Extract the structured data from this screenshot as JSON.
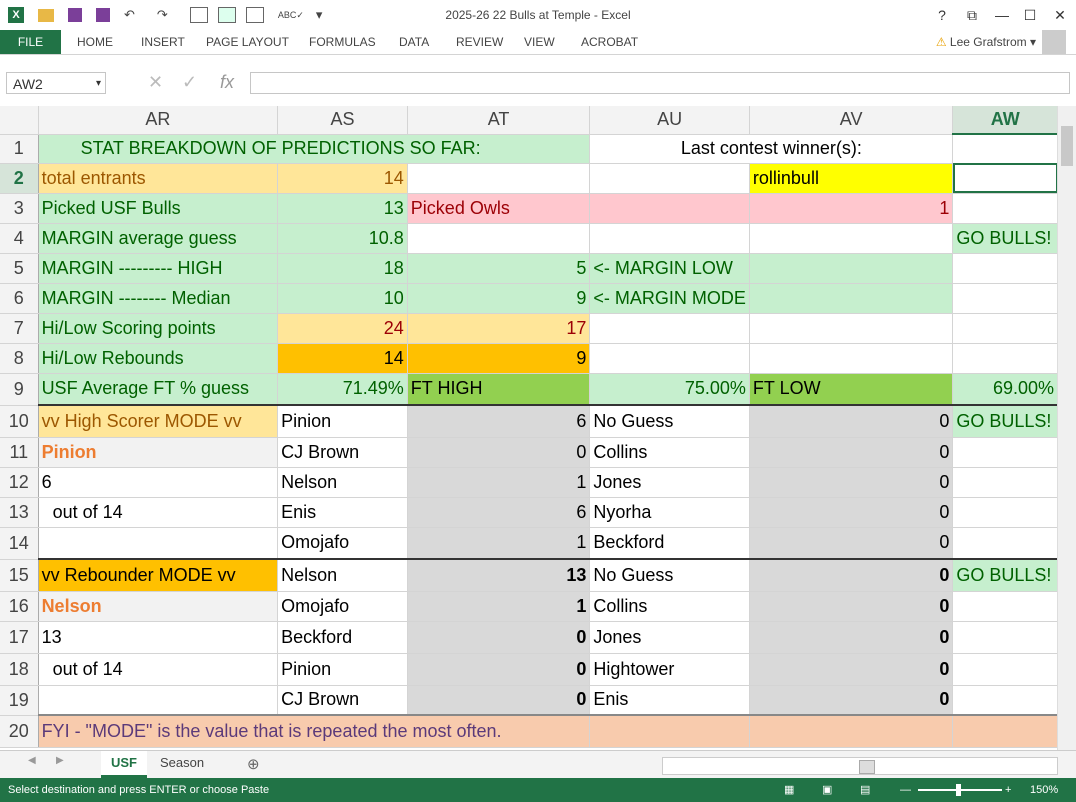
{
  "window": {
    "title": "2025-26  22 Bulls at Temple - Excel",
    "help": "?",
    "restore": "⧉",
    "minimize": "—",
    "maximize": "☐",
    "close": "✕"
  },
  "ribbon": {
    "tabs": [
      "FILE",
      "HOME",
      "INSERT",
      "PAGE LAYOUT",
      "FORMULAS",
      "DATA",
      "REVIEW",
      "VIEW",
      "ACROBAT"
    ],
    "user": "Lee Grafstrom"
  },
  "formula_bar": {
    "name_box": "AW2",
    "fx": "fx",
    "value": ""
  },
  "columns": [
    "AR",
    "AS",
    "AT",
    "AU",
    "AV",
    "AW"
  ],
  "rows": [
    {
      "n": "1",
      "cells": [
        {
          "t": "STAT BREAKDOWN OF PREDICTIONS SO FAR:",
          "c": "g",
          "span": 3,
          "indent": true
        },
        {
          "t": "Last contest winner(s):",
          "c": "",
          "span": 2,
          "center": true
        },
        {
          "t": "",
          "c": ""
        }
      ]
    },
    {
      "n": "2",
      "cells": [
        {
          "t": "total entrants",
          "c": "y"
        },
        {
          "t": "14",
          "c": "y num"
        },
        {
          "t": "",
          "c": ""
        },
        {
          "t": "",
          "c": ""
        },
        {
          "t": "rollinbull",
          "c": "yel"
        },
        {
          "t": "",
          "c": "sel"
        }
      ]
    },
    {
      "n": "3",
      "cells": [
        {
          "t": "Picked USF Bulls",
          "c": "g"
        },
        {
          "t": "13",
          "c": "g num"
        },
        {
          "t": "Picked Owls",
          "c": "pk"
        },
        {
          "t": "",
          "c": "pk"
        },
        {
          "t": "1",
          "c": "pk num"
        },
        {
          "t": "",
          "c": ""
        }
      ]
    },
    {
      "n": "4",
      "cells": [
        {
          "t": "MARGIN average guess",
          "c": "g"
        },
        {
          "t": "10.8",
          "c": "g num"
        },
        {
          "t": "",
          "c": ""
        },
        {
          "t": "",
          "c": ""
        },
        {
          "t": "",
          "c": ""
        },
        {
          "t": "GO BULLS!",
          "c": "g"
        }
      ]
    },
    {
      "n": "5",
      "cells": [
        {
          "t": "MARGIN ---------    HIGH",
          "c": "g"
        },
        {
          "t": "18",
          "c": "g num"
        },
        {
          "t": "5",
          "c": "g num"
        },
        {
          "t": "<- MARGIN LOW",
          "c": "g"
        },
        {
          "t": "",
          "c": "g"
        },
        {
          "t": "",
          "c": ""
        }
      ]
    },
    {
      "n": "6",
      "cells": [
        {
          "t": "MARGIN -------- Median",
          "c": "g"
        },
        {
          "t": "10",
          "c": "g num"
        },
        {
          "t": "9",
          "c": "g num"
        },
        {
          "t": "<- MARGIN MODE",
          "c": "g"
        },
        {
          "t": "",
          "c": "g"
        },
        {
          "t": "",
          "c": ""
        }
      ]
    },
    {
      "n": "7",
      "cells": [
        {
          "t": "Hi/Low Scoring points",
          "c": "g"
        },
        {
          "t": "24",
          "c": "y num darkred"
        },
        {
          "t": "17",
          "c": "y num darkred"
        },
        {
          "t": "",
          "c": ""
        },
        {
          "t": "",
          "c": ""
        },
        {
          "t": "",
          "c": ""
        }
      ]
    },
    {
      "n": "8",
      "cells": [
        {
          "t": "Hi/Low Rebounds",
          "c": "g"
        },
        {
          "t": "14",
          "c": "o num"
        },
        {
          "t": "9",
          "c": "o num"
        },
        {
          "t": "",
          "c": ""
        },
        {
          "t": "",
          "c": ""
        },
        {
          "t": "",
          "c": ""
        }
      ]
    },
    {
      "n": "9",
      "cells": [
        {
          "t": "USF Average FT % guess",
          "c": "g"
        },
        {
          "t": "71.49%",
          "c": "g num"
        },
        {
          "t": "FT HIGH",
          "c": "dg"
        },
        {
          "t": "75.00%",
          "c": "g num"
        },
        {
          "t": "FT LOW",
          "c": "dg"
        },
        {
          "t": "69.00%",
          "c": "g num"
        }
      ]
    },
    {
      "n": "10",
      "cells": [
        {
          "t": "vv High Scorer MODE  vv",
          "c": "y"
        },
        {
          "t": "Pinion",
          "c": ""
        },
        {
          "t": "6",
          "c": "gray num"
        },
        {
          "t": "No Guess",
          "c": ""
        },
        {
          "t": "0",
          "c": "gray num"
        },
        {
          "t": "GO BULLS!",
          "c": "g"
        }
      ]
    },
    {
      "n": "11",
      "cells": [
        {
          "t": "Pinion",
          "c": "orange-t"
        },
        {
          "t": "CJ Brown",
          "c": ""
        },
        {
          "t": "0",
          "c": "gray num"
        },
        {
          "t": "Collins",
          "c": ""
        },
        {
          "t": "0",
          "c": "gray num"
        },
        {
          "t": "",
          "c": ""
        }
      ]
    },
    {
      "n": "12",
      "cells": [
        {
          "t": "6",
          "c": ""
        },
        {
          "t": "Nelson",
          "c": ""
        },
        {
          "t": "1",
          "c": "gray num"
        },
        {
          "t": "Jones",
          "c": ""
        },
        {
          "t": "0",
          "c": "gray num"
        },
        {
          "t": "",
          "c": ""
        }
      ]
    },
    {
      "n": "13",
      "cells": [
        {
          "t": "  out of 14",
          "c": ""
        },
        {
          "t": "Enis",
          "c": ""
        },
        {
          "t": "6",
          "c": "gray num"
        },
        {
          "t": "Nyorha",
          "c": ""
        },
        {
          "t": "0",
          "c": "gray num"
        },
        {
          "t": "",
          "c": ""
        }
      ]
    },
    {
      "n": "14",
      "cells": [
        {
          "t": "",
          "c": ""
        },
        {
          "t": "Omojafo",
          "c": ""
        },
        {
          "t": "1",
          "c": "gray num"
        },
        {
          "t": "Beckford",
          "c": ""
        },
        {
          "t": "0",
          "c": "gray num"
        },
        {
          "t": "",
          "c": ""
        }
      ]
    },
    {
      "n": "15",
      "cells": [
        {
          "t": "vv  Rebounder MODE vv",
          "c": "o"
        },
        {
          "t": "Nelson",
          "c": ""
        },
        {
          "t": "13",
          "c": "gray num b"
        },
        {
          "t": "No Guess",
          "c": ""
        },
        {
          "t": "0",
          "c": "gray num b"
        },
        {
          "t": "GO BULLS!",
          "c": "g"
        }
      ]
    },
    {
      "n": "16",
      "cells": [
        {
          "t": "Nelson",
          "c": "orange-t"
        },
        {
          "t": "Omojafo",
          "c": ""
        },
        {
          "t": "1",
          "c": "gray num b"
        },
        {
          "t": "Collins",
          "c": ""
        },
        {
          "t": "0",
          "c": "gray num b"
        },
        {
          "t": "",
          "c": ""
        }
      ]
    },
    {
      "n": "17",
      "cells": [
        {
          "t": "13",
          "c": ""
        },
        {
          "t": "Beckford",
          "c": ""
        },
        {
          "t": "0",
          "c": "gray num b"
        },
        {
          "t": "Jones",
          "c": ""
        },
        {
          "t": "0",
          "c": "gray num b"
        },
        {
          "t": "",
          "c": ""
        }
      ]
    },
    {
      "n": "18",
      "cells": [
        {
          "t": "  out of 14",
          "c": ""
        },
        {
          "t": "Pinion",
          "c": ""
        },
        {
          "t": "0",
          "c": "gray num b"
        },
        {
          "t": "Hightower",
          "c": ""
        },
        {
          "t": "0",
          "c": "gray num b"
        },
        {
          "t": "",
          "c": ""
        }
      ]
    },
    {
      "n": "19",
      "cells": [
        {
          "t": "",
          "c": ""
        },
        {
          "t": "CJ Brown",
          "c": ""
        },
        {
          "t": "0",
          "c": "gray num b"
        },
        {
          "t": "Enis",
          "c": ""
        },
        {
          "t": "0",
          "c": "gray num b"
        },
        {
          "t": "",
          "c": ""
        }
      ]
    },
    {
      "n": "20",
      "cells": [
        {
          "t": "FYI  - \"MODE\" is the value that is repeated the most often.",
          "c": "peach purple",
          "span": 3
        },
        {
          "t": "",
          "c": "peach"
        },
        {
          "t": "",
          "c": "peach"
        },
        {
          "t": "",
          "c": "peach"
        }
      ]
    }
  ],
  "sheets": [
    "USF",
    "Season"
  ],
  "status": "Select destination and press ENTER or choose Paste",
  "zoom": "150%",
  "icons": {
    "excel": "excel-logo-icon",
    "folder": "folder-icon",
    "save": "save-icon",
    "undo": "undo-icon",
    "redo": "redo-icon",
    "add_sheet": "plus-circle-icon"
  },
  "colors": {
    "excel_green": "#217346",
    "good_fill": "#c6efce",
    "neutral_fill": "#ffe699",
    "orange_fill": "#ffc000",
    "bad_fill": "#ffc7ce"
  }
}
